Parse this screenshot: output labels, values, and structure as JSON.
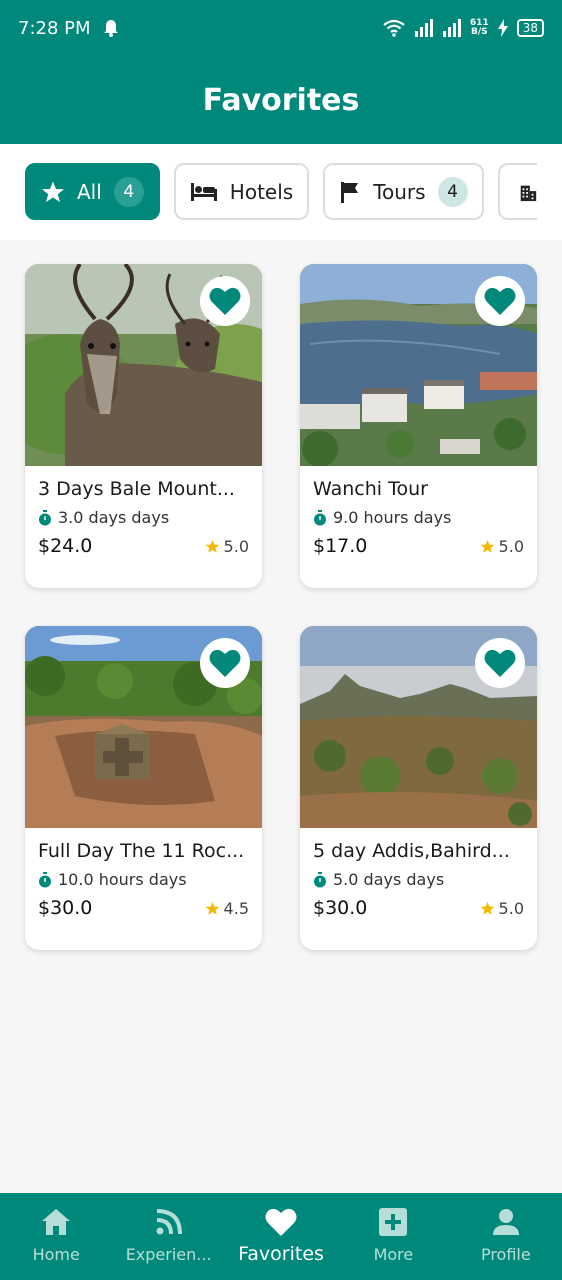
{
  "status_bar": {
    "time": "7:28 PM",
    "net_speed_top": "611",
    "net_speed_unit": "B/S",
    "battery": "38"
  },
  "app_bar": {
    "title": "Favorites"
  },
  "filters": [
    {
      "label": "All",
      "count": "4",
      "icon": "star-icon",
      "active": true
    },
    {
      "label": "Hotels",
      "icon": "bed-icon"
    },
    {
      "label": "Tours",
      "count": "4",
      "icon": "flag-icon"
    },
    {
      "label": "",
      "icon": "building-icon"
    }
  ],
  "cards": [
    {
      "title": "3 Days Bale Mount...",
      "duration": "3.0 days days",
      "price": "$24.0",
      "rating": "5.0"
    },
    {
      "title": "Wanchi Tour",
      "duration": "9.0 hours days",
      "price": "$17.0",
      "rating": "5.0"
    },
    {
      "title": "Full Day The 11 Roc...",
      "duration": "10.0 hours days",
      "price": "$30.0",
      "rating": "4.5"
    },
    {
      "title": "5 day Addis,Bahird...",
      "duration": "5.0 days days",
      "price": "$30.0",
      "rating": "5.0"
    }
  ],
  "bottom_nav": [
    {
      "label": "Home",
      "icon": "home-icon"
    },
    {
      "label": "Experien...",
      "icon": "feed-icon"
    },
    {
      "label": "Favorites",
      "icon": "heart-icon",
      "active": true
    },
    {
      "label": "More",
      "icon": "add-box-icon"
    },
    {
      "label": "Profile",
      "icon": "person-icon"
    }
  ],
  "colors": {
    "primary": "#00897b",
    "star": "#f5b800",
    "heart": "#00897b"
  }
}
